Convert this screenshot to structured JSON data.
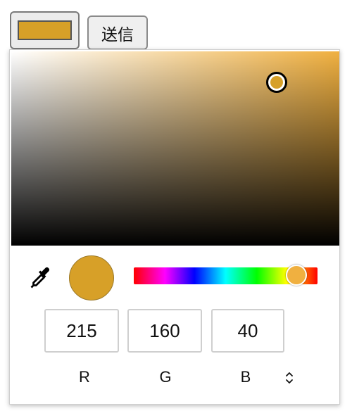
{
  "selected_color": "#d7a028",
  "submit_button": {
    "label": "送信"
  },
  "color_picker": {
    "hue_color": "#f0b040",
    "saturation": 0.81,
    "value": 0.84,
    "hue_degrees": 41,
    "channels": [
      {
        "label": "R",
        "value": "215"
      },
      {
        "label": "G",
        "value": "160"
      },
      {
        "label": "B",
        "value": "40"
      }
    ],
    "icons": {
      "eyedropper": "eyedropper-icon",
      "format_toggle": "up-down-chevron-icon"
    }
  }
}
